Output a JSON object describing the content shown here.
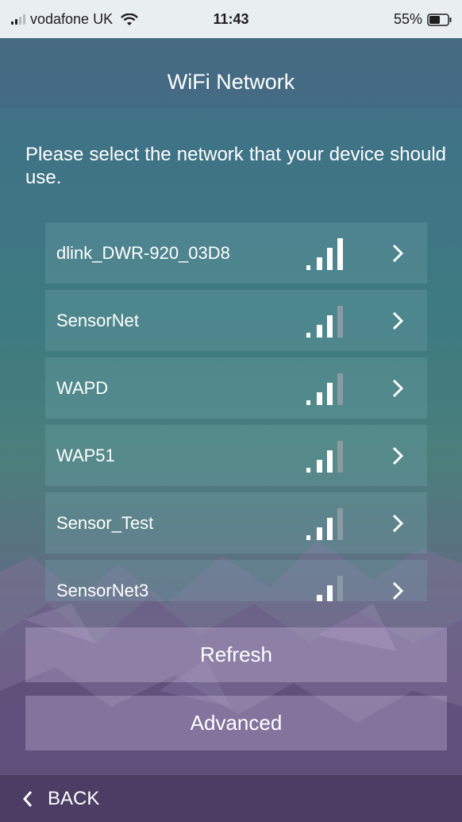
{
  "status_bar": {
    "carrier": "vodafone UK",
    "time": "11:43",
    "battery": "55%"
  },
  "nav": {
    "title": "WiFi Network"
  },
  "instruction": "Please select the network that your device should use.",
  "networks": [
    {
      "name": "dlink_DWR-920_03D8",
      "signal_bars": 4
    },
    {
      "name": "SensorNet",
      "signal_bars": 3
    },
    {
      "name": "WAPD",
      "signal_bars": 3
    },
    {
      "name": "WAP51",
      "signal_bars": 3
    },
    {
      "name": "Sensor_Test",
      "signal_bars": 3
    },
    {
      "name": "SensorNet3",
      "signal_bars": 3
    }
  ],
  "buttons": {
    "refresh": "Refresh",
    "advanced": "Advanced"
  },
  "footer": {
    "back": "BACK"
  },
  "colors": {
    "status_bar_bg": "#e9eef1",
    "bar_active": "#ffffff",
    "bar_inactive": "#8a9aa3"
  }
}
